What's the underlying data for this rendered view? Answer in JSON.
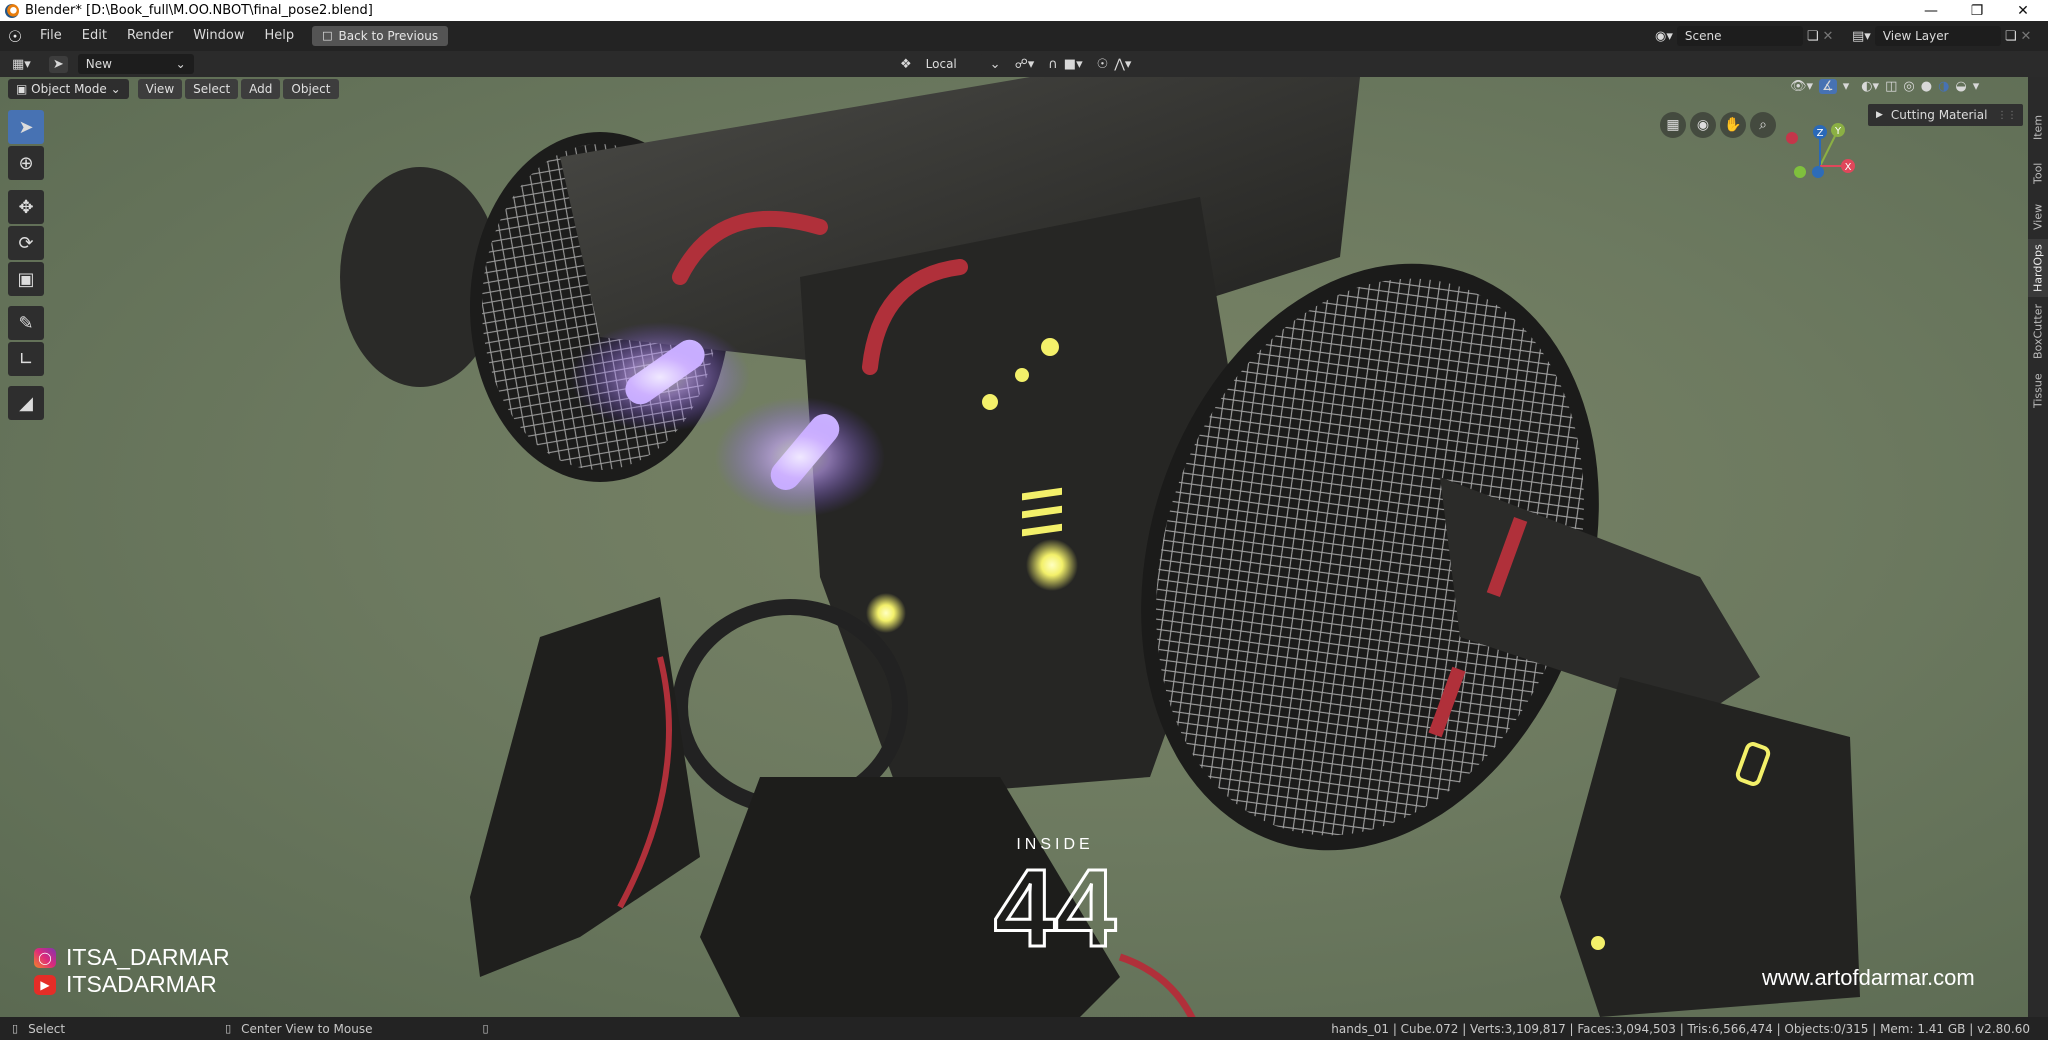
{
  "window": {
    "title": "Blender* [D:\\Book_full\\M.OO.NBOT\\final_pose2.blend]"
  },
  "menu": {
    "items": [
      "File",
      "Edit",
      "Render",
      "Window",
      "Help"
    ],
    "back_button": "Back to Previous",
    "scene_label": "Scene",
    "view_layer_label": "View Layer"
  },
  "header": {
    "new_button": "New",
    "transform_orientation": "Local",
    "mode": "Object Mode",
    "view_menu": [
      "View",
      "Select",
      "Add",
      "Object"
    ]
  },
  "side_panel": {
    "cutting_material": "Cutting Material",
    "tabs": [
      "Item",
      "Tool",
      "View",
      "HardOps",
      "BoxCutter",
      "Tissue"
    ],
    "active_tab": "HardOps"
  },
  "overlay": {
    "instagram": "ITSA_DARMAR",
    "youtube": "ITSADARMAR",
    "website": "www.artofdarmar.com",
    "watermark_top": "INSIDE",
    "watermark_main": "44"
  },
  "gizmo": {
    "z": "Z",
    "y": "Y",
    "x": "X"
  },
  "status": {
    "left_action": "Select",
    "middle_action": "Center View to Mouse",
    "stats": "hands_01 | Cube.072 | Verts:3,109,817 | Faces:3,094,503 | Tris:6,566,474 | Objects:0/315 | Mem: 1.41 GB | v2.80.60"
  },
  "colors": {
    "accent": "#4772b3",
    "viewport_bg": "#6d7a60",
    "glow_purple": "#b98cff",
    "glow_yellow": "#f3f06a",
    "cable_red": "#b0303a"
  }
}
